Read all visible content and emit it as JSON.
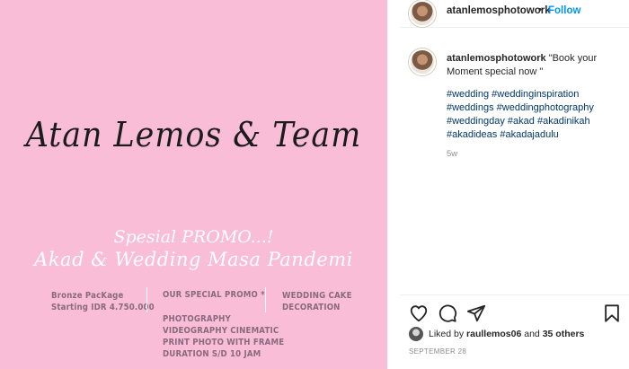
{
  "post": {
    "image": {
      "title": "Atan Lemos & Team",
      "promo_line1": "Spesial PROMO...!",
      "promo_line2": "Akad & Wedding Masa Pandemi",
      "bronze": [
        "Bronze PacKage",
        "Starting IDR 4.750.000"
      ],
      "special_header": "OUR SPECIAL PROMO *",
      "special_items": [
        "PHOTOGRAPHY",
        "VIDEOGRAPHY CINEMATIC",
        "PRINT PHOTO WITH FRAME",
        "DURATION S/D 10 JAM"
      ],
      "extras": [
        "WEDDING CAKE",
        "DECORATION"
      ],
      "background_color": "#f9bdd8"
    },
    "header": {
      "username": "atanlemosphotowork",
      "separator": "•",
      "follow_label": "Follow"
    },
    "caption": {
      "username": "atanlemosphotowork",
      "text": "\"Book your Moment special now \"",
      "hashtags": [
        "#wedding",
        "#weddinginspiration",
        "#weddings",
        "#weddingphotography",
        "#weddingday",
        "#akad",
        "#akadinikah",
        "#akadideas",
        "#akadajadulu"
      ],
      "time_ago": "5w"
    },
    "actions": {
      "icons": [
        "heart-icon",
        "comment-icon",
        "share-icon",
        "bookmark-icon"
      ]
    },
    "likes": {
      "prefix": "Liked by",
      "user": "raullemos06",
      "joiner": "and",
      "others": "35 others"
    },
    "date": "SEPTEMBER 28"
  },
  "colors": {
    "link": "#00376b",
    "follow": "#0095f6",
    "muted": "#8e8e8e"
  }
}
